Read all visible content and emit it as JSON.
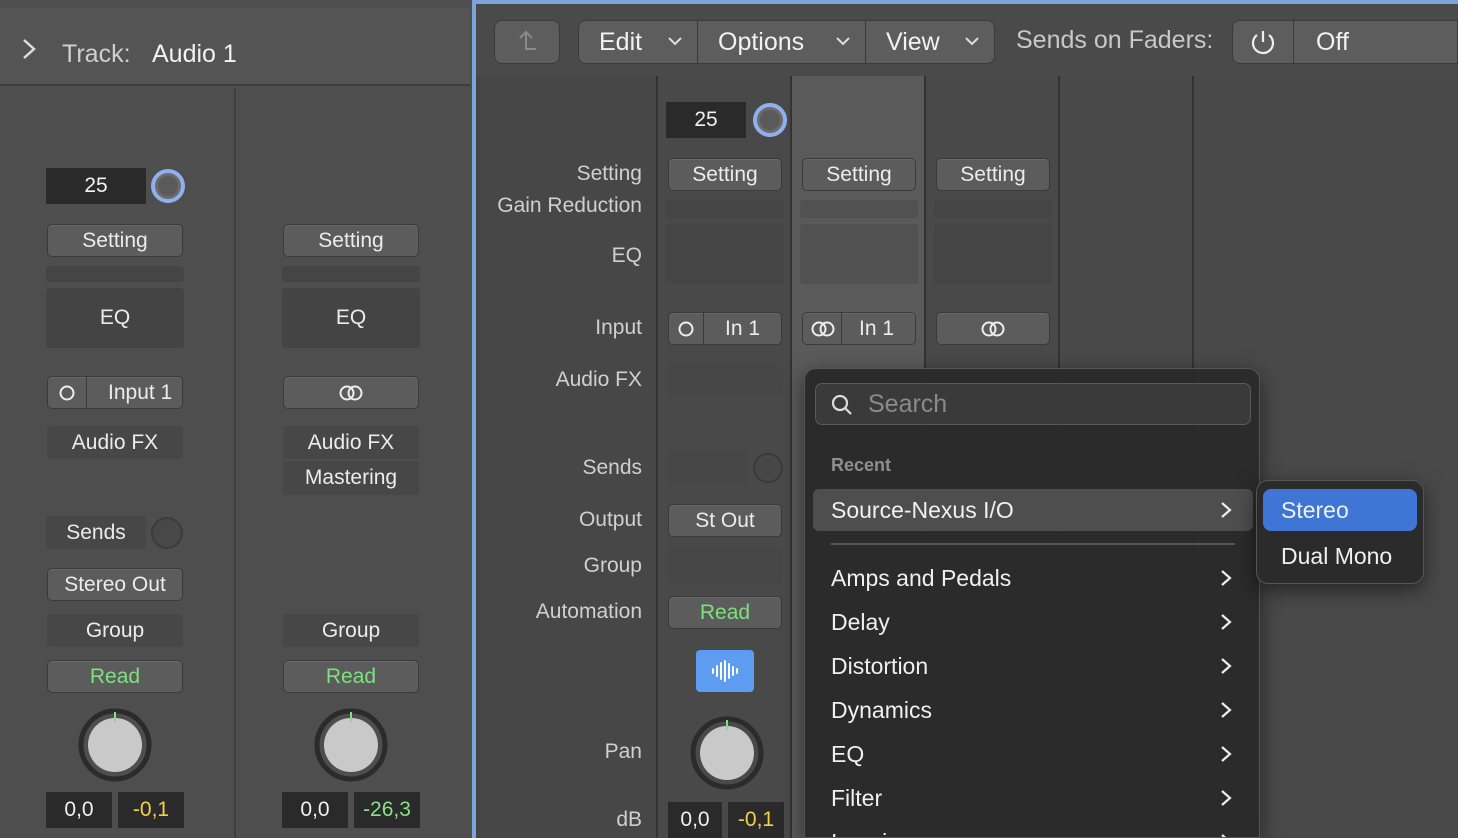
{
  "inspector": {
    "header_label": "Track:",
    "track_name": "Audio 1",
    "left_strip": {
      "gain_value": "25",
      "setting": "Setting",
      "eq": "EQ",
      "input": "Input 1",
      "audio_fx": "Audio FX",
      "sends": "Sends",
      "output": "Stereo Out",
      "group": "Group",
      "automation": "Read",
      "volume": "0,0",
      "peak": "-0,1"
    },
    "right_strip": {
      "setting": "Setting",
      "eq": "EQ",
      "audio_fx_1": "Audio FX",
      "audio_fx_2": "Mastering",
      "group": "Group",
      "automation": "Read",
      "volume": "0,0",
      "peak": "-26,3"
    }
  },
  "toolbar": {
    "edit": "Edit",
    "options": "Options",
    "view": "View",
    "sends_on_faders_label": "Sends on Faders:",
    "sends_state": "Off"
  },
  "row_labels": {
    "setting": "Setting",
    "gain_reduction": "Gain Reduction",
    "eq": "EQ",
    "input": "Input",
    "audio_fx": "Audio FX",
    "sends": "Sends",
    "output": "Output",
    "group": "Group",
    "automation": "Automation",
    "pan": "Pan",
    "db": "dB"
  },
  "strips": {
    "strip1": {
      "gain_value": "25",
      "setting": "Setting",
      "input": "In 1",
      "output": "St Out",
      "automation": "Read",
      "volume": "0,0",
      "peak": "-0,1"
    },
    "strip2": {
      "setting": "Setting",
      "input": "In 1"
    },
    "strip3": {
      "setting": "Setting"
    }
  },
  "popup": {
    "search_placeholder": "Search",
    "recent_header": "Recent",
    "items": [
      "Source-Nexus I/O",
      "Amps and Pedals",
      "Delay",
      "Distortion",
      "Dynamics",
      "EQ",
      "Filter",
      "Imaging"
    ],
    "submenu": [
      "Stereo",
      "Dual Mono"
    ]
  },
  "colors": {
    "accent": "#3f75d4",
    "read_green": "#7ee07e",
    "peak_yellow": "#f1d04a",
    "selection_border": "#7da4d8"
  }
}
